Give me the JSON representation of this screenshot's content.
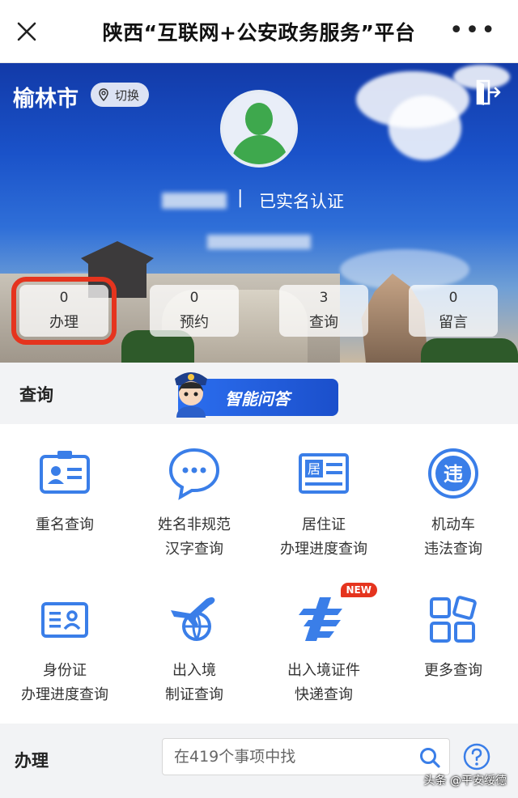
{
  "topbar": {
    "title": "陕西“互联网+公安政务服务”平台"
  },
  "hero": {
    "city": "榆林市",
    "switch_label": "切换",
    "verified_label": "已实名认证",
    "separator": "|"
  },
  "stats": [
    {
      "count": "0",
      "label": "办理"
    },
    {
      "count": "0",
      "label": "预约"
    },
    {
      "count": "3",
      "label": "查询"
    },
    {
      "count": "0",
      "label": "留言"
    }
  ],
  "query": {
    "section_label": "查询",
    "ai_banner": "智能问答"
  },
  "grid": [
    {
      "line1": "重名查询",
      "line2": ""
    },
    {
      "line1": "姓名非规范",
      "line2": "汉字查询"
    },
    {
      "line1": "居住证",
      "line2": "办理进度查询"
    },
    {
      "line1": "机动车",
      "line2": "违法查询"
    },
    {
      "line1": "身份证",
      "line2": "办理进度查询"
    },
    {
      "line1": "出入境",
      "line2": "制证查询"
    },
    {
      "line1": "出入境证件",
      "line2": "快递查询"
    },
    {
      "line1": "更多查询",
      "line2": ""
    }
  ],
  "icon_text": {
    "residence": "居",
    "violation": "违"
  },
  "new_badge": "NEW",
  "handle": {
    "section_label": "办理",
    "search_placeholder": "在419个事项中找"
  },
  "watermark": "头条 @平安绥德",
  "colors": {
    "accent": "#3a7ee8",
    "highlight": "#e5341e",
    "avatar": "#3ea84d"
  }
}
